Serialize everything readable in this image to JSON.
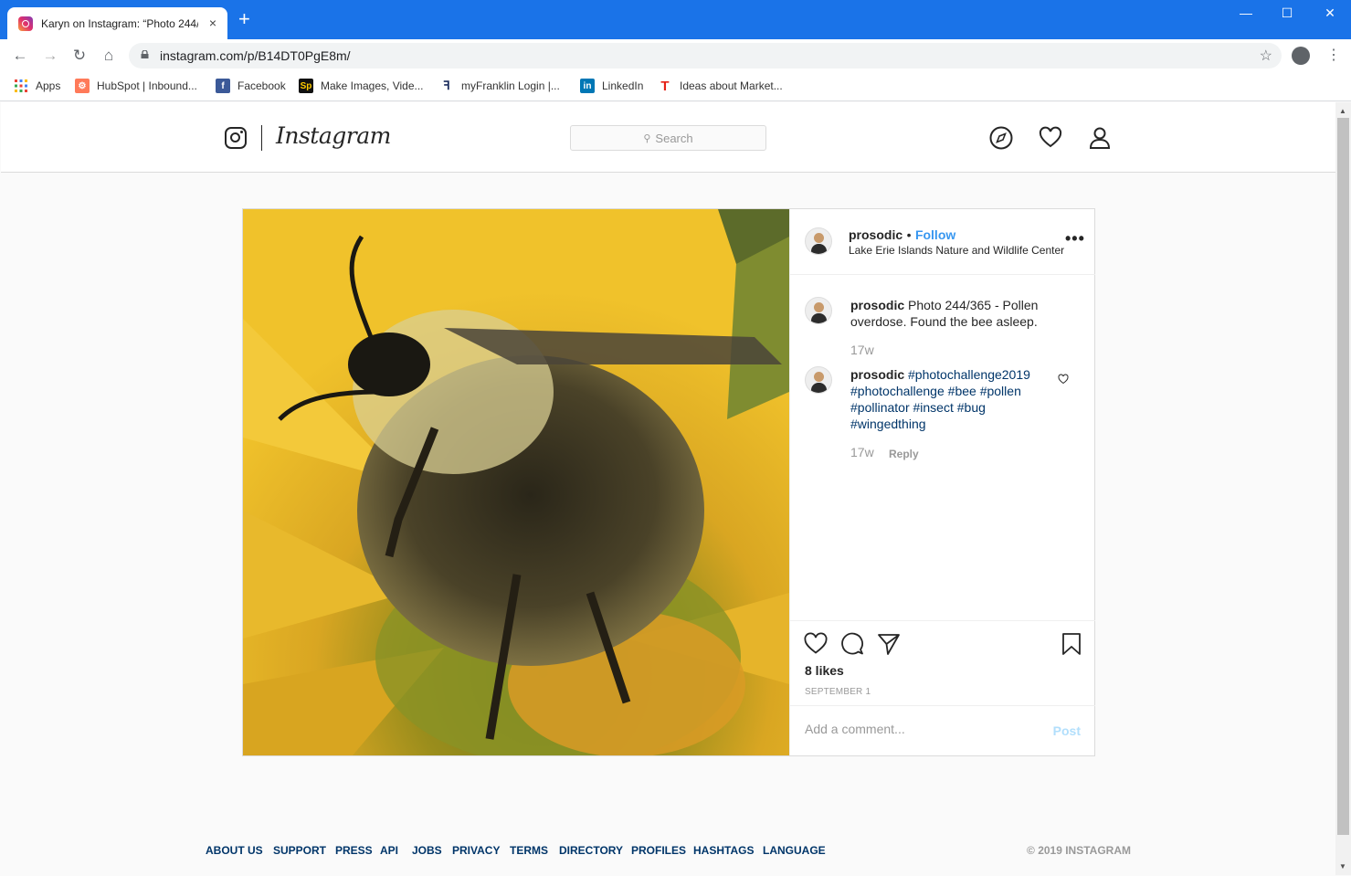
{
  "browser": {
    "tab_title": "Karyn on Instagram: “Photo 244/",
    "tab_close": "×",
    "new_tab": "+",
    "url": "instagram.com/p/B14DT0PgE8m/",
    "bookmarks": [
      {
        "label": "Apps",
        "icon": "apps-grid-icon",
        "color": "#4285f4"
      },
      {
        "label": "HubSpot | Inbound...",
        "icon": "hubspot-icon",
        "color": "#ff7a59"
      },
      {
        "label": "Facebook",
        "icon": "facebook-icon",
        "color": "#3b5998"
      },
      {
        "label": "Make Images, Vide...",
        "icon": "spark-icon",
        "color": "#000000"
      },
      {
        "label": "myFranklin Login |...",
        "icon": "franklin-icon",
        "color": "#1a2b5c"
      },
      {
        "label": "LinkedIn",
        "icon": "linkedin-icon",
        "color": "#0077b5"
      },
      {
        "label": "Ideas about Market...",
        "icon": "t-icon",
        "color": "#e62117"
      }
    ]
  },
  "instagram": {
    "wordmark": "Instagram",
    "search_placeholder": "Search",
    "post": {
      "username": "prosodic",
      "follow_label": "Follow",
      "dot": "•",
      "location": "Lake Erie Islands Nature and Wildlife Center",
      "more": "•••",
      "caption": "Photo 244/365 - Pollen overdose. Found the bee asleep.",
      "caption_time": "17w",
      "comment_user": "prosodic",
      "comment_tags": [
        "#photochallenge2019",
        "#photochallenge",
        "#bee",
        "#pollen",
        "#pollinator",
        "#insect",
        "#bug",
        "#wingedthing"
      ],
      "comment_time": "17w",
      "reply_label": "Reply",
      "likes": "8 likes",
      "date": "SEPTEMBER 1",
      "comment_placeholder": "Add a comment...",
      "post_button": "Post"
    },
    "footer": {
      "links": [
        "ABOUT US",
        "SUPPORT",
        "PRESS",
        "API",
        "JOBS",
        "PRIVACY",
        "TERMS",
        "DIRECTORY",
        "PROFILES",
        "HASHTAGS",
        "LANGUAGE"
      ],
      "copyright": "© 2019 INSTAGRAM"
    }
  },
  "colors": {
    "chrome_blue": "#1a73e8",
    "link_blue": "#3897f0",
    "hashtag": "#003569"
  }
}
